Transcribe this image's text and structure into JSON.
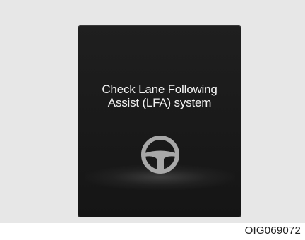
{
  "display": {
    "message_line1": "Check Lane Following",
    "message_line2": "Assist (LFA) system",
    "icon": "steering-wheel-icon",
    "background_color": "#1b1b1b",
    "icon_color": "#a8a8a8"
  },
  "figure_code": "OIG069072"
}
